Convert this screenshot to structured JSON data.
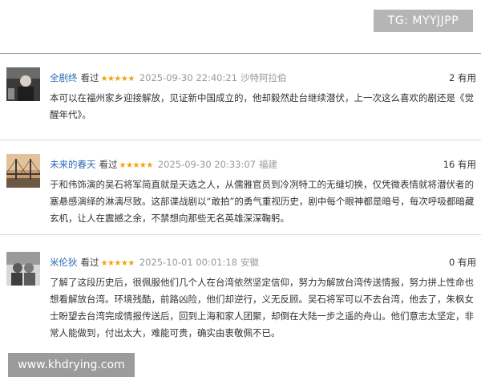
{
  "watermark_top": "TG: MYYJJPP",
  "watermark_bottom": "www.khdrying.com",
  "comments": [
    {
      "username": "全剧终",
      "watched": "看过",
      "stars": "★★★★★",
      "time": "2025-09-30 22:40:21",
      "location": "沙特阿拉伯",
      "useful": "2 有用",
      "text": "本可以在福州家乡迎接解放，见证新中国成立的，他却毅然赴台继续潜伏，上一次这么喜欢的剧还是《觉醒年代》。"
    },
    {
      "username": "未来的春天",
      "watched": "看过",
      "stars": "★★★★★",
      "time": "2025-09-30 20:33:07",
      "location": "福建",
      "useful": "16 有用",
      "text": "于和伟饰演的吴石将军简直就是天选之人，从儒雅官员到冷冽特工的无缝切换，仅凭微表情就将潜伏者的塞悬感演绎的淋漓尽致。这部谍战剧以“敢拍”的勇气重视历史，剧中每个眼神都是暗号，每次呼吸都暗藏玄机，让人在震撼之余，不禁想向那些无名英雄深深鞠躬。"
    },
    {
      "username": "米伦狄",
      "watched": "看过",
      "stars": "★★★★★",
      "time": "2025-10-01 00:01:18",
      "location": "安徽",
      "useful": "0 有用",
      "text": "了解了这段历史后，很佩服他们几个人在台湾依然坚定信仰，努力为解放台湾传送情报，努力拼上性命也想看解放台湾。环境残酷，前路凶险，他们却逆行，义无反顾。吴石将军可以不去台湾，他去了，朱枫女士盼望去台湾完成情报传送后，回到上海和家人团聚，却倒在大陆一步之遥的舟山。他们意志太坚定，非常人能做到，付出太大，难能可贵，确实由衷敬佩不已。"
    }
  ]
}
